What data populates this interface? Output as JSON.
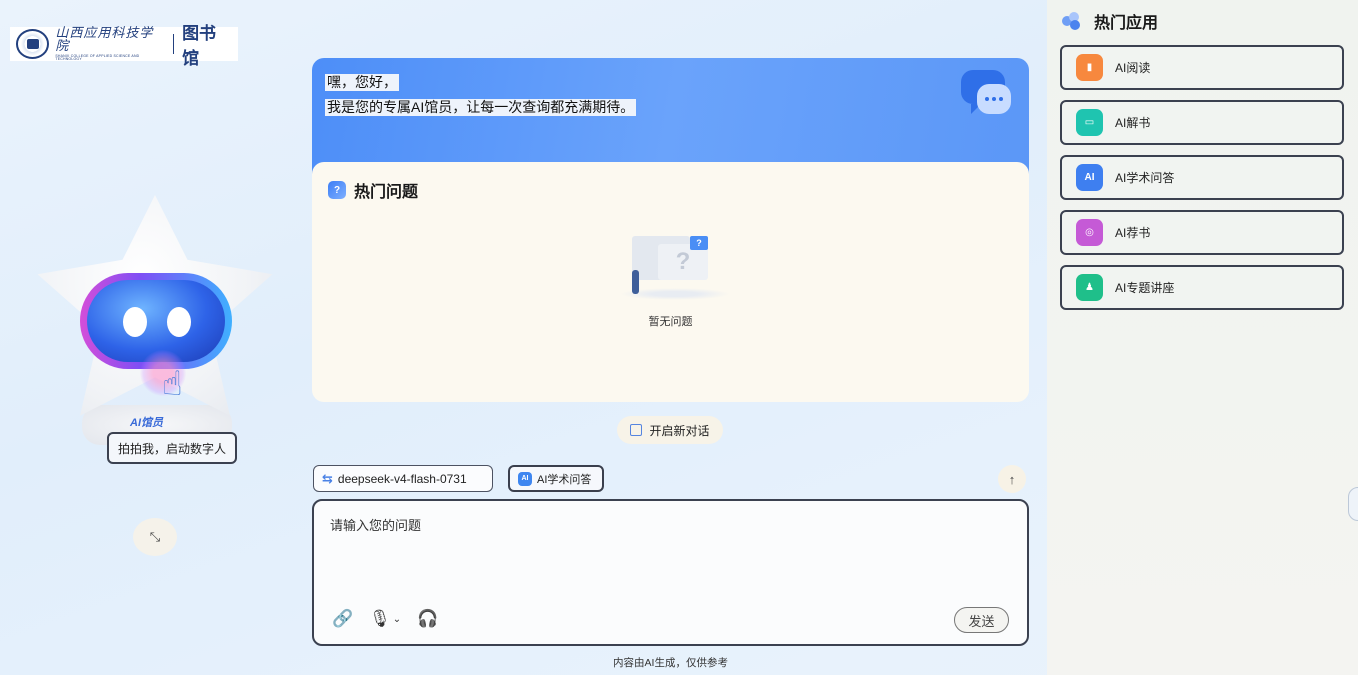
{
  "header": {
    "school_name": "山西应用科技学院",
    "school_name_en": "SHANXI COLLEGE OF APPLIED SCIENCE AND TECHNOLOGY",
    "library": "图书馆"
  },
  "avatar": {
    "body_label": "AI馆员",
    "start_button": "拍拍我，启动数字人"
  },
  "greeting": {
    "line1": "嘿，您好，",
    "line2": "我是您的专属AI馆员，让每一次查询都充满期待。"
  },
  "hot_questions": {
    "title": "热门问题",
    "empty_text": "暂无问题"
  },
  "new_chat_label": "开启新对话",
  "model_selector": "deepseek-v4-flash-0731",
  "mode_selector": "AI学术问答",
  "input": {
    "placeholder": "请输入您的问题",
    "value": ""
  },
  "send_label": "发送",
  "disclaimer": "内容由AI生成，仅供参考",
  "right_panel": {
    "title": "热门应用",
    "apps": [
      {
        "label": "AI阅读",
        "icon": "book-icon",
        "color": "#f7883e"
      },
      {
        "label": "AI解书",
        "icon": "book-open-icon",
        "color": "#1fc4b0"
      },
      {
        "label": "AI学术问答",
        "icon": "ai-chat-icon",
        "color": "#3e7ff0"
      },
      {
        "label": "AI荐书",
        "icon": "recommend-icon",
        "color": "#c55ad6"
      },
      {
        "label": "AI专题讲座",
        "icon": "lecture-icon",
        "color": "#1fbf8a"
      }
    ]
  },
  "colors": {
    "accent": "#4d8ef8",
    "border": "#3b4150"
  }
}
